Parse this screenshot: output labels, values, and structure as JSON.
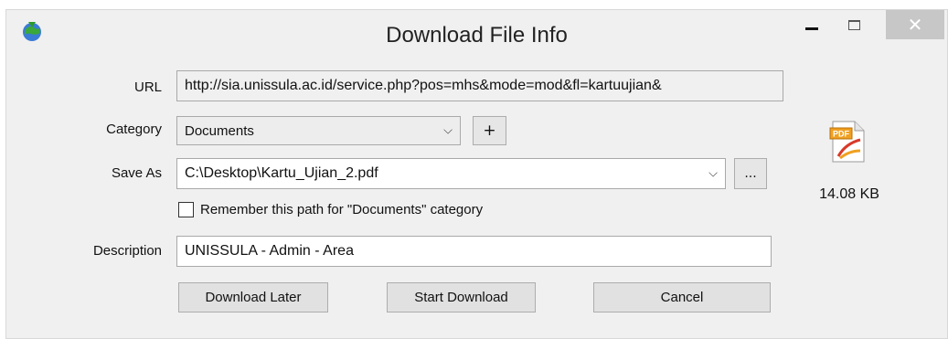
{
  "window": {
    "title": "Download File Info",
    "icons": {
      "app": "idm-globe-icon",
      "minimize": "minimize-icon",
      "maximize": "maximize-icon",
      "close": "close-icon"
    },
    "close_glyph": "✕"
  },
  "url": {
    "label": "URL",
    "value": "http://sia.unissula.ac.id/service.php?pos=mhs&mode=mod&fl=kartuujian&"
  },
  "category": {
    "label": "Category",
    "value": "Documents",
    "add_label": "+"
  },
  "save_as": {
    "label": "Save As",
    "value": "C:\\Desktop\\Kartu_Ujian_2.pdf",
    "browse_label": "..."
  },
  "remember": {
    "label": "Remember this path for \"Documents\" category",
    "checked": false
  },
  "description": {
    "label": "Description",
    "value": "UNISSULA - Admin - Area"
  },
  "file": {
    "icon": "pdf-file-icon",
    "size": "14.08  KB"
  },
  "buttons": {
    "download_later": "Download Later",
    "start_download": "Start Download",
    "cancel": "Cancel"
  },
  "dropdown_glyph": "⌵"
}
